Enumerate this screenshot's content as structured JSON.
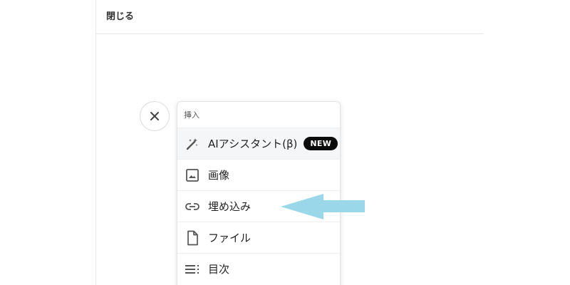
{
  "header": {
    "close_label": "閉じる"
  },
  "toolbar": {
    "close_icon": "close-icon"
  },
  "insert_menu": {
    "heading": "挿入",
    "items": [
      {
        "label": "AIアシスタント(β)",
        "icon": "magic-wand-icon",
        "badge": "NEW"
      },
      {
        "label": "画像",
        "icon": "image-icon"
      },
      {
        "label": "埋め込み",
        "icon": "link-icon"
      },
      {
        "label": "ファイル",
        "icon": "file-icon"
      },
      {
        "label": "目次",
        "icon": "table-of-contents-icon"
      }
    ]
  },
  "colors": {
    "badge_bg": "#0b0b0b",
    "arrow": "#9ad7e8",
    "icon": "#555555"
  }
}
